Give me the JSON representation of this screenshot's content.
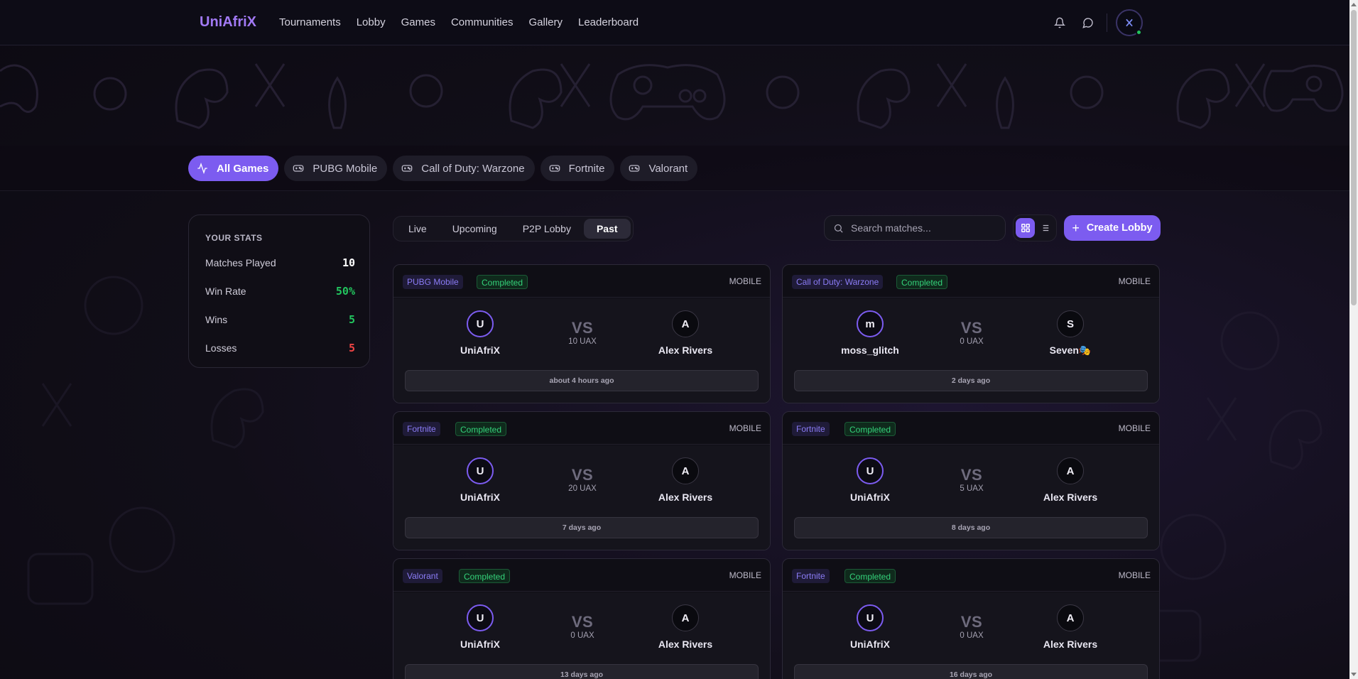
{
  "brand": "UniAfriX",
  "nav": [
    "Tournaments",
    "Lobby",
    "Games",
    "Communities",
    "Gallery",
    "Leaderboard"
  ],
  "game_filters": [
    {
      "label": "All Games",
      "icon": "activity-icon",
      "active": true
    },
    {
      "label": "PUBG Mobile",
      "icon": "gamepad-icon",
      "active": false
    },
    {
      "label": "Call of Duty: Warzone",
      "icon": "gamepad-icon",
      "active": false
    },
    {
      "label": "Fortnite",
      "icon": "gamepad-icon",
      "active": false
    },
    {
      "label": "Valorant",
      "icon": "gamepad-icon",
      "active": false
    }
  ],
  "stats": {
    "title": "YOUR STATS",
    "rows": [
      {
        "label": "Matches Played",
        "value": "10",
        "color": "#ffffff"
      },
      {
        "label": "Win Rate",
        "value": "50%",
        "color": "#22c55e"
      },
      {
        "label": "Wins",
        "value": "5",
        "color": "#22c55e"
      },
      {
        "label": "Losses",
        "value": "5",
        "color": "#ef4444"
      }
    ]
  },
  "tabs": [
    {
      "label": "Live",
      "active": false
    },
    {
      "label": "Upcoming",
      "active": false
    },
    {
      "label": "P2P Lobby",
      "active": false
    },
    {
      "label": "Past",
      "active": true
    }
  ],
  "search": {
    "placeholder": "Search matches..."
  },
  "create_label": "Create Lobby",
  "vs_label": "VS",
  "matches": [
    {
      "game": "PUBG Mobile",
      "status": "Completed",
      "platform": "MOBILE",
      "p1": {
        "initial": "U",
        "name": "UniAfriX"
      },
      "p2": {
        "initial": "A",
        "name": "Alex Rivers"
      },
      "stake": "10 UAX",
      "time": "about 4 hours ago"
    },
    {
      "game": "Call of Duty: Warzone",
      "status": "Completed",
      "platform": "MOBILE",
      "p1": {
        "initial": "m",
        "name": "moss_glitch"
      },
      "p2": {
        "initial": "S",
        "name": "Seven🎭"
      },
      "stake": "0 UAX",
      "time": "2 days ago"
    },
    {
      "game": "Fortnite",
      "status": "Completed",
      "platform": "MOBILE",
      "p1": {
        "initial": "U",
        "name": "UniAfriX"
      },
      "p2": {
        "initial": "A",
        "name": "Alex Rivers"
      },
      "stake": "20 UAX",
      "time": "7 days ago"
    },
    {
      "game": "Fortnite",
      "status": "Completed",
      "platform": "MOBILE",
      "p1": {
        "initial": "U",
        "name": "UniAfriX"
      },
      "p2": {
        "initial": "A",
        "name": "Alex Rivers"
      },
      "stake": "5 UAX",
      "time": "8 days ago"
    },
    {
      "game": "Valorant",
      "status": "Completed",
      "platform": "MOBILE",
      "p1": {
        "initial": "U",
        "name": "UniAfriX"
      },
      "p2": {
        "initial": "A",
        "name": "Alex Rivers"
      },
      "stake": "0 UAX",
      "time": "13 days ago"
    },
    {
      "game": "Fortnite",
      "status": "Completed",
      "platform": "MOBILE",
      "p1": {
        "initial": "U",
        "name": "UniAfriX"
      },
      "p2": {
        "initial": "A",
        "name": "Alex Rivers"
      },
      "stake": "0 UAX",
      "time": "16 days ago"
    }
  ],
  "colors": {
    "accent": "#7c5cf0",
    "brand": "#a27af5",
    "success": "#22c55e",
    "danger": "#ef4444"
  }
}
